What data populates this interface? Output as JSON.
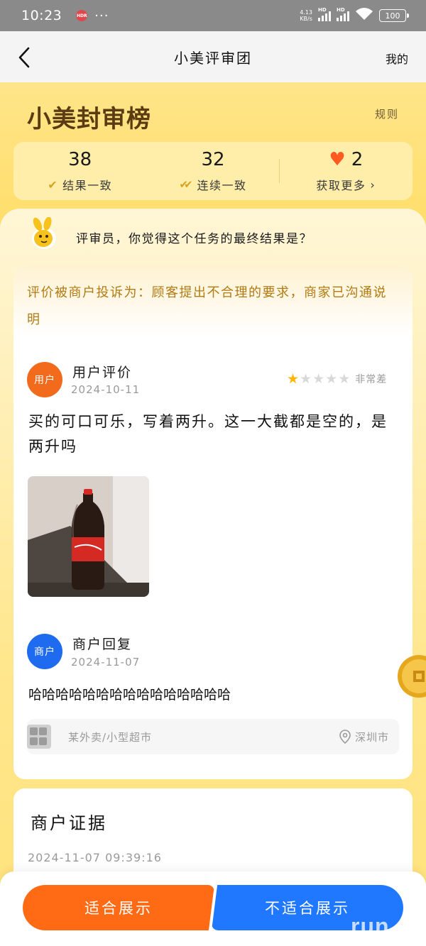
{
  "status_bar": {
    "time": "10:23",
    "hdr_badge": "HDR",
    "more": "···",
    "net_speed_value": "4.13",
    "net_speed_unit": "KB/s",
    "signal1_label": "HD",
    "signal2_label": "HD",
    "battery": "100"
  },
  "nav": {
    "title": "小美评审团",
    "mine": "我的"
  },
  "hero": {
    "title": "小美封审榜",
    "rules": "规则"
  },
  "stats": [
    {
      "value": "38",
      "label": "结果一致"
    },
    {
      "value": "32",
      "label": "连续一致"
    },
    {
      "value": "2",
      "label": "获取更多"
    }
  ],
  "question": "评审员，你觉得这个任务的最终结果是？",
  "complaint": "评价被商户投诉为：顾客提出不合理的要求，商家已沟通说明",
  "user_review": {
    "avatar_text": "用户",
    "name": "用户评价",
    "date": "2024-10-11",
    "rating": 1,
    "rating_max": 5,
    "rating_label": "非常差",
    "text": "买的可口可乐，写着两升。这一大截都是空的，是两升吗"
  },
  "merchant_reply": {
    "avatar_text": "商户",
    "name": "商户回复",
    "date": "2024-11-07",
    "text": "哈哈哈哈哈哈哈哈哈哈哈哈哈哈哈"
  },
  "store": {
    "name": "某外卖/小型超市",
    "city": "深圳市"
  },
  "evidence": {
    "title": "商户证据",
    "time": "2024-11-07 09:39:16"
  },
  "actions": {
    "suitable": "适合展示",
    "unsuitable": "不适合展示"
  },
  "watermark": "run",
  "colors": {
    "accent_orange": "#ff6a14",
    "accent_blue": "#1f78ff",
    "hero_yellow": "#FFDE6B",
    "complaint_text": "#b27a10"
  }
}
